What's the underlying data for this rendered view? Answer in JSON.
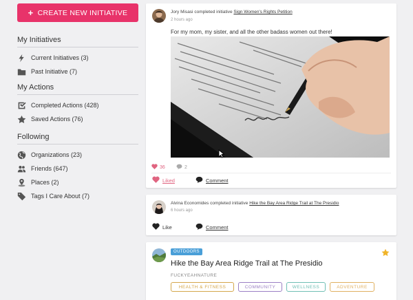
{
  "sidebar": {
    "create_button": "CREATE NEW INITIATIVE",
    "sections": [
      {
        "title": "My Initiatives",
        "items": [
          {
            "label": "Current Initiatives (3)",
            "icon": "lightning-icon"
          },
          {
            "label": "Past Initiative (7)",
            "icon": "folder-icon"
          }
        ]
      },
      {
        "title": "My Actions",
        "items": [
          {
            "label": "Completed Actions (428)",
            "icon": "checkbox-icon"
          },
          {
            "label": "Saved Actions (76)",
            "icon": "star-icon"
          }
        ]
      },
      {
        "title": "Following",
        "items": [
          {
            "label": "Organizations (23)",
            "icon": "globe-icon"
          },
          {
            "label": "Friends (647)",
            "icon": "people-icon"
          },
          {
            "label": "Places (2)",
            "icon": "map-pin-icon"
          },
          {
            "label": "Tags I Care About (7)",
            "icon": "tag-icon"
          }
        ]
      }
    ]
  },
  "feed": {
    "post1": {
      "author": "Jory Misasi",
      "verb": "completed initiative",
      "initiative": "Sign Women's Rights Petition",
      "time": "2 hours ago",
      "text": "For my mom, my sister, and all the other badass women out there!",
      "likes": "36",
      "comments": "2",
      "like_label": "Liked",
      "comment_label": "Comment"
    },
    "post2": {
      "author": "Alvina Economides",
      "verb": "completed initiative",
      "initiative": "Hike the Bay Area Ridge Trail at The Presidio",
      "time": "6 hours ago",
      "like_label": "Like",
      "comment_label": "Comment"
    },
    "initiative_card": {
      "category": "OUTDOORS",
      "title": "Hike the Bay Area Ridge Trail at The Presidio",
      "organization": "FUCKYEAHNATURE",
      "tags": [
        {
          "label": "HEALTH & FITNESS",
          "color": "#d4a64a"
        },
        {
          "label": "COMMUNITY",
          "color": "#9b7fc4"
        },
        {
          "label": "WELLNESS",
          "color": "#6fbfb4"
        },
        {
          "label": "ADVENTURE",
          "color": "#e0b060"
        }
      ]
    }
  },
  "colors": {
    "accent": "#e8336a",
    "star": "#f0b429",
    "badge": "#4a9fd8"
  }
}
